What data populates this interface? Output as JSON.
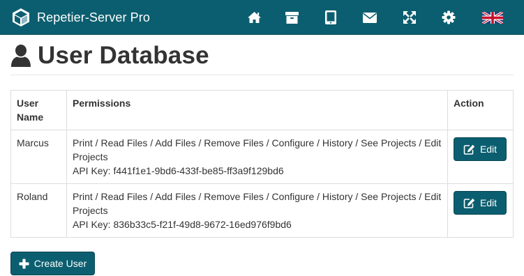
{
  "app": {
    "brand_name": "Repetier-Server Pro",
    "colors": {
      "navbar": "#0b5e6f",
      "button": "#0b5e6f",
      "text": "#333333",
      "border": "#dddddd"
    }
  },
  "navbar": {
    "icons": [
      "home-icon",
      "archive-icon",
      "tablet-icon",
      "envelope-icon",
      "fullscreen-icon",
      "gear-icon",
      "uk-flag-icon"
    ]
  },
  "page": {
    "title": "User Database",
    "title_icon": "user-icon"
  },
  "table": {
    "headers": {
      "name": "User Name",
      "permissions": "Permissions",
      "action": "Action"
    },
    "rows": [
      {
        "name": "Marcus",
        "permissions": "Print / Read Files / Add Files / Remove Files / Configure / History / See Projects / Edit Projects",
        "api_key_label": "API Key:",
        "api_key": "f441f1e1-9bd6-433f-be85-ff3a9f129bd6",
        "action_label": "Edit"
      },
      {
        "name": "Roland",
        "permissions": "Print / Read Files / Add Files / Remove Files / Configure / History / See Projects / Edit Projects",
        "api_key_label": "API Key:",
        "api_key": "836b33c5-f21f-49d8-9672-16ed976f9bd6",
        "action_label": "Edit"
      }
    ]
  },
  "buttons": {
    "create_user": "Create User"
  }
}
